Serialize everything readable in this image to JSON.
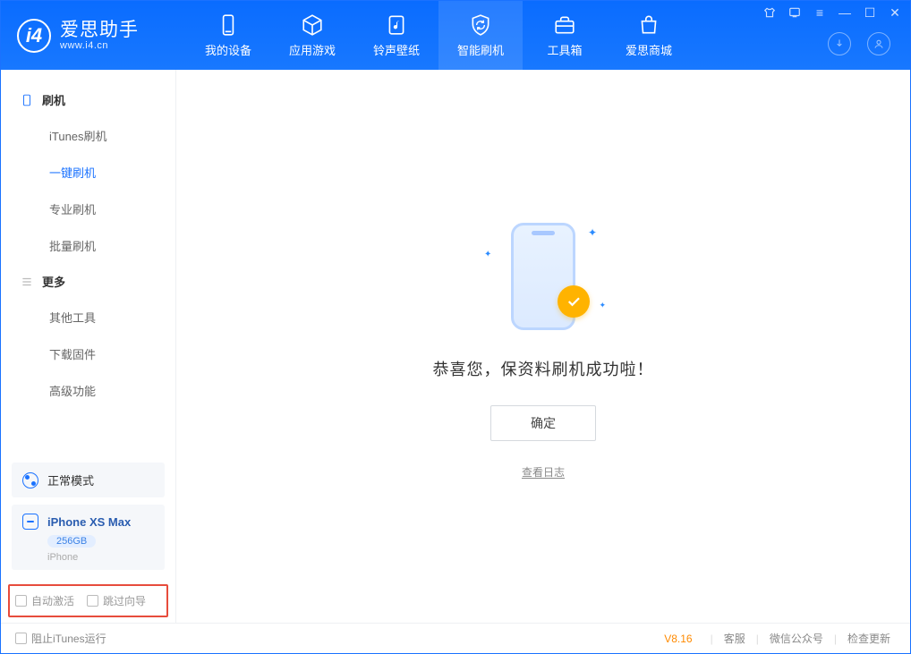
{
  "app": {
    "title": "爱思助手",
    "subtitle": "www.i4.cn"
  },
  "nav": {
    "items": [
      {
        "label": "我的设备",
        "icon": "device"
      },
      {
        "label": "应用游戏",
        "icon": "cube"
      },
      {
        "label": "铃声壁纸",
        "icon": "music"
      },
      {
        "label": "智能刷机",
        "icon": "shield",
        "active": true
      },
      {
        "label": "工具箱",
        "icon": "toolbox"
      },
      {
        "label": "爱思商城",
        "icon": "bag"
      }
    ]
  },
  "sidebar": {
    "sec1_title": "刷机",
    "sec1_items": [
      "iTunes刷机",
      "一键刷机",
      "专业刷机",
      "批量刷机"
    ],
    "active_index": 1,
    "sec2_title": "更多",
    "sec2_items": [
      "其他工具",
      "下载固件",
      "高级功能"
    ],
    "status_label": "正常模式",
    "device": {
      "name": "iPhone XS Max",
      "capacity": "256GB",
      "type": "iPhone"
    },
    "opt_auto_activate": "自动激活",
    "opt_skip_guide": "跳过向导"
  },
  "main": {
    "success_text": "恭喜您，保资料刷机成功啦！",
    "ok_button": "确定",
    "view_log": "查看日志"
  },
  "footer": {
    "block_itunes": "阻止iTunes运行",
    "version": "V8.16",
    "links": [
      "客服",
      "微信公众号",
      "检查更新"
    ]
  }
}
